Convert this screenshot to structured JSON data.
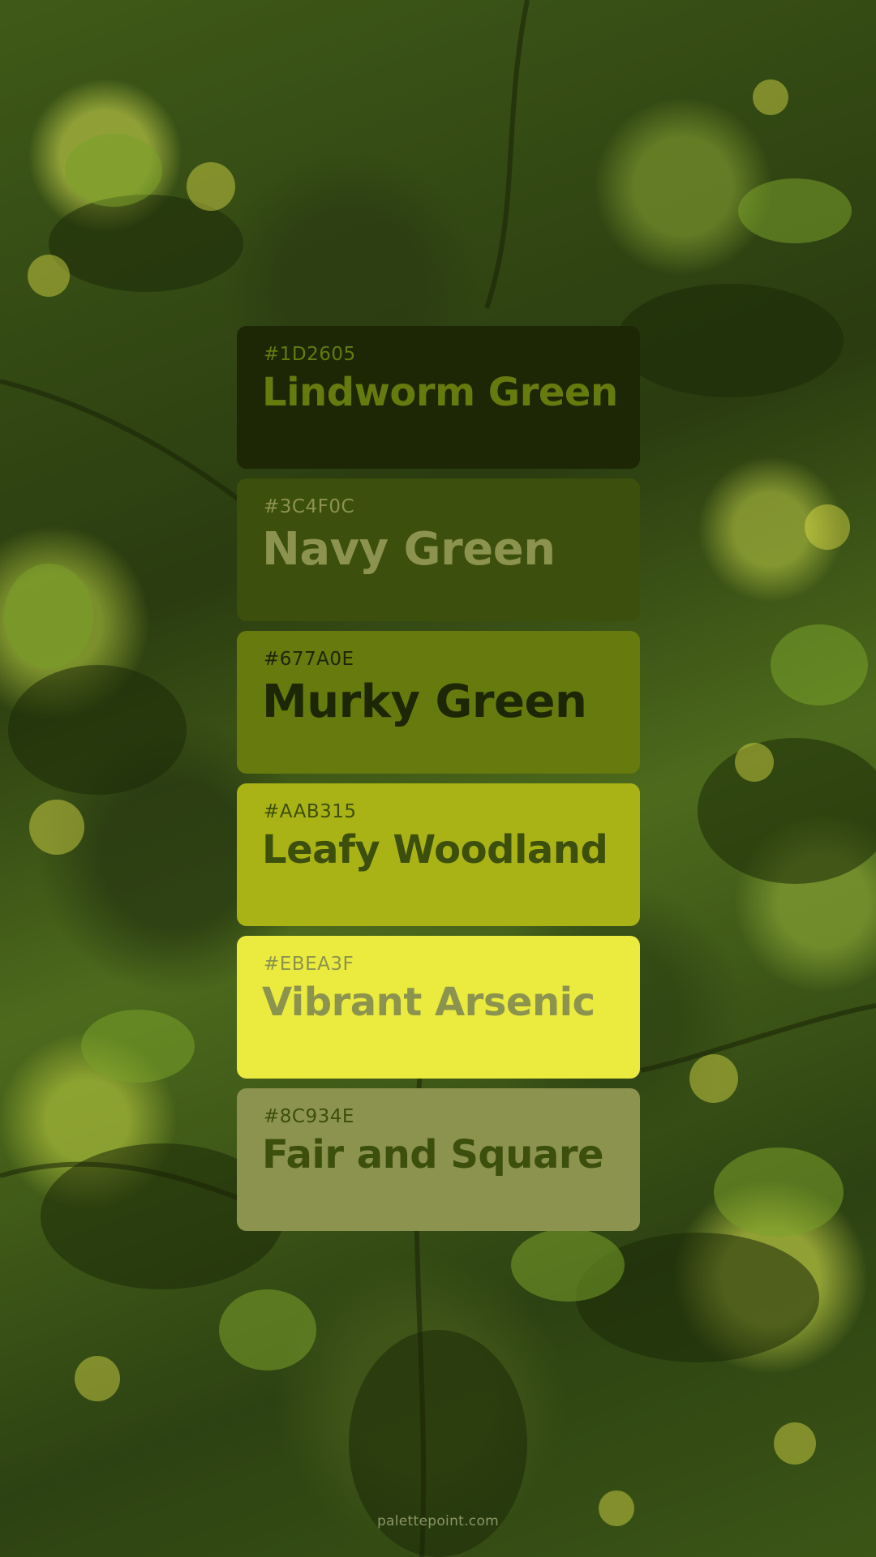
{
  "palette": [
    {
      "hex": "#1D2605",
      "name": "Lindworm Green",
      "bg": "#1D2605",
      "text_color": "#677A0E"
    },
    {
      "hex": "#3C4F0C",
      "name": "Navy Green",
      "bg": "#3C4F0C",
      "text_color": "#8C934E"
    },
    {
      "hex": "#677A0E",
      "name": "Murky Green",
      "bg": "#677A0E",
      "text_color": "#1D2605"
    },
    {
      "hex": "#AAB315",
      "name": "Leafy Woodland",
      "bg": "#AAB315",
      "text_color": "#3C4F0C"
    },
    {
      "hex": "#EBEA3F",
      "name": "Vibrant Arsenic",
      "bg": "#EBEA3F",
      "text_color": "#8C934E"
    },
    {
      "hex": "#8C934E",
      "name": "Fair and Square",
      "bg": "#8C934E",
      "text_color": "#3C4F0C"
    }
  ],
  "footer": {
    "site": "palettepoint.com"
  }
}
